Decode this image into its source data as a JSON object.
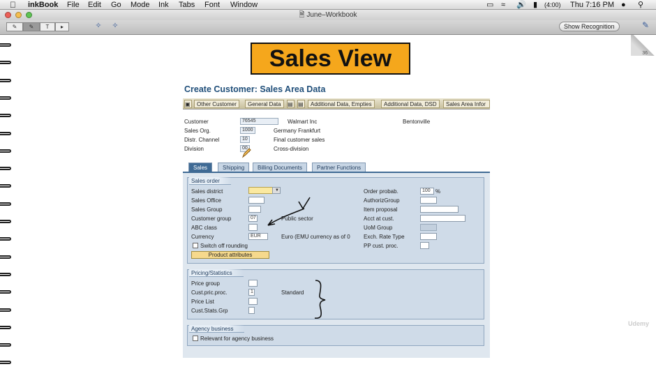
{
  "menubar": {
    "app": "inkBook",
    "items": [
      "File",
      "Edit",
      "Go",
      "Mode",
      "Ink",
      "Tabs",
      "Font",
      "Window"
    ],
    "battery": "(4:00)",
    "clock": "Thu 7:16 PM"
  },
  "window": {
    "title": "June–Workbook",
    "show_recognition": "Show Recognition",
    "page_number": "36",
    "watermark": "Udemy"
  },
  "banner": "Sales View",
  "sap": {
    "title": "Create Customer: Sales Area Data",
    "toolbar": [
      "Other Customer",
      "General Data",
      "Additional Data, Empties",
      "Additional Data, DSD",
      "Sales Area Infor"
    ],
    "header": {
      "customer_label": "Customer",
      "customer_value": "76545",
      "customer_name": "Walmart Inc",
      "customer_city": "Bentonville",
      "salesorg_label": "Sales Org.",
      "salesorg_value": "1000",
      "salesorg_text": "Germany Frankfurt",
      "channel_label": "Distr. Channel",
      "channel_value": "10",
      "channel_text": "Final customer sales",
      "division_label": "Division",
      "division_value": "00",
      "division_text": "Cross-division"
    },
    "tabs": [
      "Sales",
      "Shipping",
      "Billing Documents",
      "Partner Functions"
    ],
    "sales_order": {
      "title": "Sales order",
      "sales_district": "Sales district",
      "sales_office": "Sales Office",
      "sales_group": "Sales Group",
      "customer_group": "Customer group",
      "customer_group_value": "07",
      "customer_group_text": "Public sector",
      "abc_class": "ABC class",
      "currency": "Currency",
      "currency_value": "EUR",
      "currency_text": "Euro (EMU currency as of 0",
      "switch_off_rounding": "Switch off rounding",
      "product_attributes": "Product attributes",
      "order_probab": "Order probab.",
      "order_probab_value": "100",
      "order_probab_unit": "%",
      "authoriz_group": "AuthorizGroup",
      "item_proposal": "Item proposal",
      "acct_at_cust": "Acct at cust.",
      "uom_group": "UoM Group",
      "exch_rate_type": "Exch. Rate Type",
      "pp_cust_proc": "PP cust. proc."
    },
    "pricing": {
      "title": "Pricing/Statistics",
      "price_group": "Price group",
      "cust_pric_proc": "Cust.pric.proc.",
      "cust_pric_proc_value": "1",
      "cust_pric_proc_text": "Standard",
      "price_list": "Price List",
      "cust_stats_grp": "Cust.Stats.Grp"
    },
    "agency": {
      "title": "Agency business",
      "relevant": "Relevant for agency business"
    }
  }
}
